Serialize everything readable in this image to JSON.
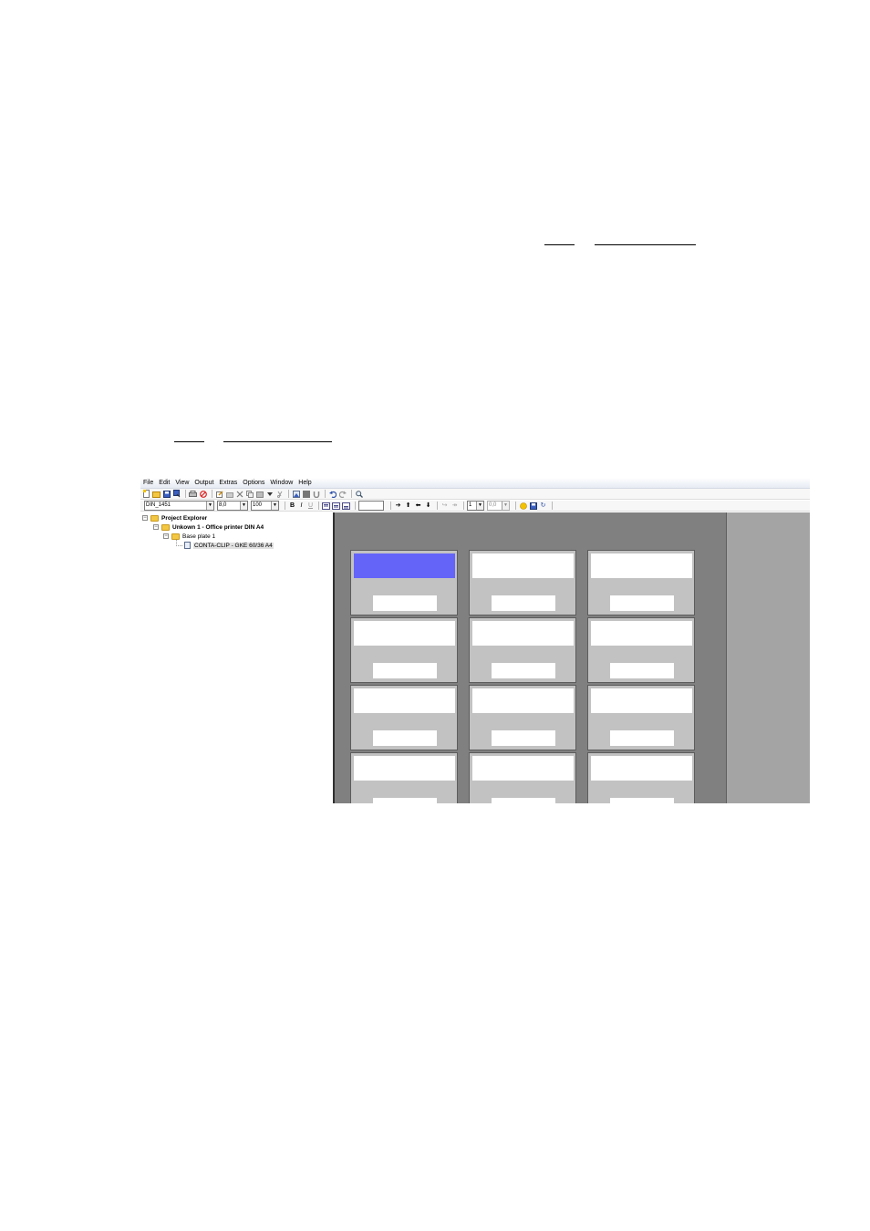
{
  "menu": [
    "File",
    "Edit",
    "View",
    "Output",
    "Extras",
    "Options",
    "Window",
    "Help"
  ],
  "toolbar1_icons": [
    "new-icon",
    "open-icon",
    "save-icon",
    "save-as-icon",
    "print-icon",
    "stop-icon",
    "edit-icon",
    "edit2-icon",
    "delete-icon",
    "copy-icon",
    "paste-icon",
    "dropdown-icon",
    "cut-icon",
    "image-icon",
    "fill-icon",
    "magnet-icon",
    "undo-icon",
    "redo-icon",
    "zoom-icon"
  ],
  "format_bar": {
    "font": "DIN_1451",
    "size": "8,0",
    "scale": "100",
    "bold": "B",
    "italic": "I",
    "underline": "U",
    "line_count": "1",
    "spacing": "0,0"
  },
  "explorer": {
    "root": "Project Explorer",
    "project": "Unkown 1 - Office printer DIN A4",
    "plate": "Base plate 1",
    "item": "CONTA-CLIP -  GKE 60/36 A4"
  },
  "colors": {
    "active_label": "#6464f9",
    "canvas": "#808080",
    "workspace": "#a4a4a4",
    "cell": "#c2c2c2"
  },
  "grid": {
    "rows": 4,
    "cols": 3,
    "active_cell": 0
  }
}
